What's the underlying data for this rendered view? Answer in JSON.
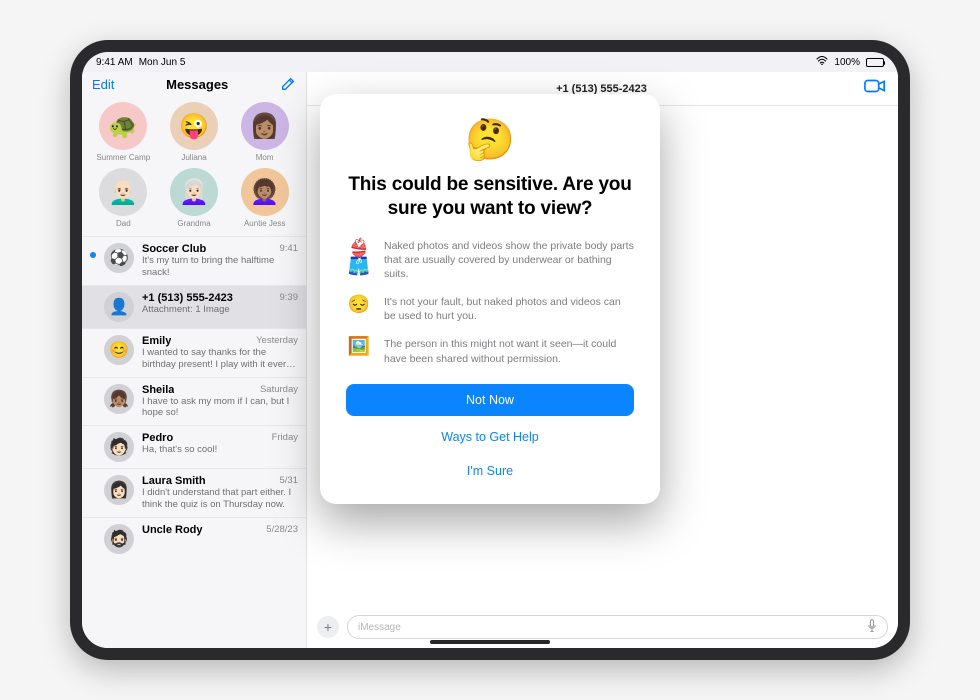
{
  "status": {
    "time": "9:41 AM",
    "date": "Mon Jun 5",
    "battery": "100%"
  },
  "sidebar": {
    "edit": "Edit",
    "title": "Messages",
    "pins": [
      {
        "label": "Summer Camp",
        "emoji": "🐢",
        "bg": "bg-pink"
      },
      {
        "label": "Juliana",
        "emoji": "😜",
        "bg": "bg-warm"
      },
      {
        "label": "Mom",
        "emoji": "👩🏽",
        "bg": "bg-purple"
      },
      {
        "label": "Dad",
        "emoji": "👨🏻‍🦲",
        "bg": "bg-gray"
      },
      {
        "label": "Grandma",
        "emoji": "👩🏻‍🦳",
        "bg": "bg-teal"
      },
      {
        "label": "Auntie Jess",
        "emoji": "👩🏽‍🦱",
        "bg": "bg-orange"
      }
    ],
    "conversations": [
      {
        "name": "Soccer Club",
        "time": "9:41",
        "preview": "It's my turn to bring the halftime snack!",
        "unread": true,
        "emoji": "⚽"
      },
      {
        "name": "+1 (513) 555-2423",
        "time": "9:39",
        "preview": "Attachment: 1 Image",
        "selected": true,
        "emoji": "👤"
      },
      {
        "name": "Emily",
        "time": "Yesterday",
        "preview": "I wanted to say thanks for the birthday present! I play with it every day in the yard!",
        "emoji": "😊"
      },
      {
        "name": "Sheila",
        "time": "Saturday",
        "preview": "I have to ask my mom if I can, but I hope so!",
        "emoji": "👧🏽"
      },
      {
        "name": "Pedro",
        "time": "Friday",
        "preview": "Ha, that's so cool!",
        "emoji": "🧑🏻"
      },
      {
        "name": "Laura Smith",
        "time": "5/31",
        "preview": "I didn't understand that part either. I think the quiz is on Thursday now.",
        "emoji": "👩🏻"
      },
      {
        "name": "Uncle Rody",
        "time": "5/28/23",
        "preview": "",
        "emoji": "🧔🏻"
      }
    ]
  },
  "main": {
    "title": "+1 (513) 555-2423",
    "compose_placeholder": "iMessage"
  },
  "modal": {
    "emoji": "🤔",
    "title": "This could be sensitive. Are you sure you want to view?",
    "rows": [
      {
        "icon": "👙🩳",
        "text": "Naked photos and videos show the private body parts that are usually covered by underwear or bathing suits."
      },
      {
        "icon": "😔",
        "text": "It's not your fault, but naked photos and videos can be used to hurt you."
      },
      {
        "icon": "🖼️",
        "text": "The person in this might not want it seen—it could have been shared without permission."
      }
    ],
    "primary": "Not Now",
    "help": "Ways to Get Help",
    "confirm": "I'm Sure"
  }
}
